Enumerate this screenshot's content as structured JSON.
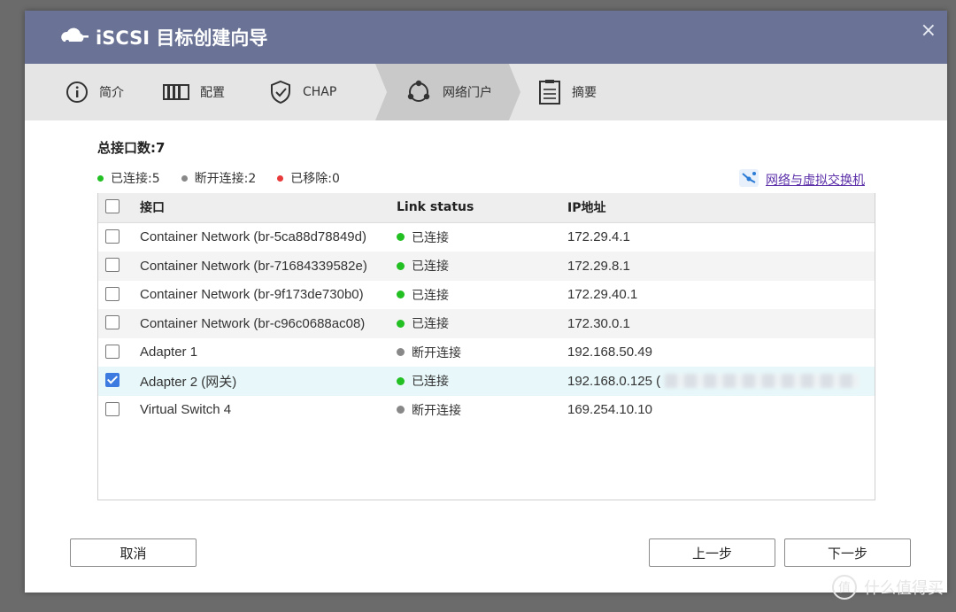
{
  "title": "iSCSI 目标创建向导",
  "close_glyph": "×",
  "steps": [
    {
      "label": "简介",
      "icon": "info-icon"
    },
    {
      "label": "配置",
      "icon": "config-icon"
    },
    {
      "label": "CHAP",
      "icon": "shield-check-icon"
    },
    {
      "label": "网络门户",
      "icon": "network-portal-icon",
      "active": true
    },
    {
      "label": "摘要",
      "icon": "summary-icon"
    }
  ],
  "total_label": "总接口数:7",
  "legend": {
    "connected": "已连接:5",
    "disconnected": "断开连接:2",
    "removed": "已移除:0"
  },
  "network_link": "网络与虚拟交换机",
  "table": {
    "headers": {
      "interface": "接口",
      "link_status": "Link status",
      "ip": "IP地址"
    },
    "rows": [
      {
        "name": "Container Network (br-5ca88d78849d)",
        "status": "已连接",
        "ip": "172.29.4.1",
        "checked": false
      },
      {
        "name": "Container Network (br-71684339582e)",
        "status": "已连接",
        "ip": "172.29.8.1",
        "checked": false
      },
      {
        "name": "Container Network (br-9f173de730b0)",
        "status": "已连接",
        "ip": "172.29.40.1",
        "checked": false
      },
      {
        "name": "Container Network (br-c96c0688ac08)",
        "status": "已连接",
        "ip": "172.30.0.1",
        "checked": false
      },
      {
        "name": "Adapter 1",
        "status": "断开连接",
        "ip": "192.168.50.49",
        "checked": false
      },
      {
        "name": "Adapter 2 (网关)",
        "status": "已连接",
        "ip": "192.168.0.125 (",
        "checked": true
      },
      {
        "name": "Virtual Switch 4",
        "status": "断开连接",
        "ip": "169.254.10.10",
        "checked": false
      }
    ]
  },
  "buttons": {
    "cancel": "取消",
    "prev": "上一步",
    "next": "下一步"
  },
  "watermark": "什么值得买",
  "watermark_badge": "值",
  "colors": {
    "titlebar": "#6a7395",
    "connected": "#22c022",
    "disconnected": "#888888",
    "removed": "#e83a3a",
    "link": "#5b2fa8"
  }
}
